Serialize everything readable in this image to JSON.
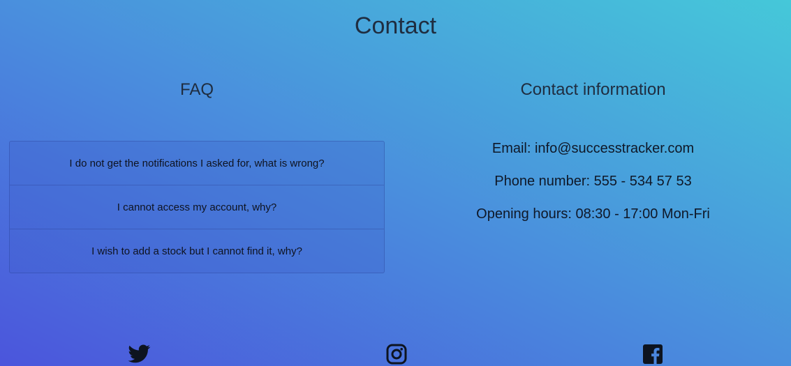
{
  "page": {
    "title": "Contact"
  },
  "faq": {
    "title": "FAQ",
    "items": [
      {
        "question": "I do not get the notifications I asked for, what is wrong?"
      },
      {
        "question": "I cannot access my account, why?"
      },
      {
        "question": "I wish to add a stock but I cannot find it, why?"
      }
    ]
  },
  "contact": {
    "title": "Contact information",
    "email": "Email: info@successtracker.com",
    "phone": "Phone number: 555 - 534 57 53",
    "hours": "Opening hours: 08:30 - 17:00 Mon-Fri"
  },
  "social": {
    "icons": [
      "twitter-icon",
      "instagram-icon",
      "facebook-icon"
    ]
  }
}
